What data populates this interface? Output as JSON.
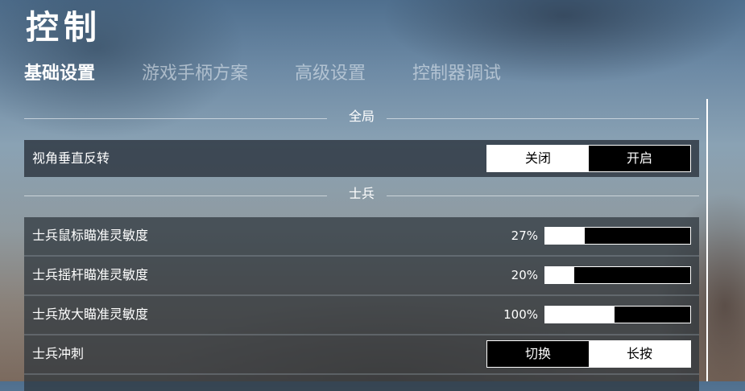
{
  "title": "控制",
  "tabs": [
    {
      "label": "基础设置",
      "active": true
    },
    {
      "label": "游戏手柄方案",
      "active": false
    },
    {
      "label": "高级设置",
      "active": false
    },
    {
      "label": "控制器调试",
      "active": false
    }
  ],
  "sections": {
    "global": {
      "label": "全局"
    },
    "soldier": {
      "label": "士兵"
    }
  },
  "rows": {
    "invert": {
      "label": "视角垂直反转",
      "options": [
        "关闭",
        "开启"
      ],
      "selected": "关闭"
    },
    "mouse_sens": {
      "label": "士兵鼠标瞄准灵敏度",
      "value_text": "27%",
      "fill": 0.27
    },
    "stick_sens": {
      "label": "士兵摇杆瞄准灵敏度",
      "value_text": "20%",
      "fill": 0.2
    },
    "zoom_sens": {
      "label": "士兵放大瞄准灵敏度",
      "value_text": "100%",
      "fill": 0.48
    },
    "sprint": {
      "label": "士兵冲刺",
      "options": [
        "切换",
        "长按"
      ],
      "selected": "长按"
    }
  }
}
